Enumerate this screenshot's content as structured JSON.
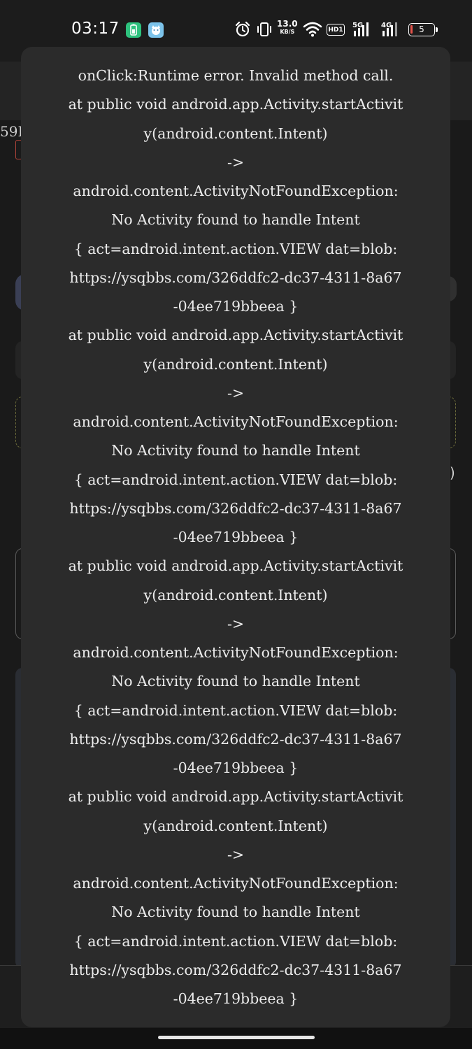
{
  "status_bar": {
    "time": "03:17",
    "net_speed_value": "13.0",
    "net_speed_unit": "KB/S",
    "hd_label": "HD1",
    "signal_1_label": "5G",
    "signal_2_label": "4G",
    "battery_level": "5",
    "icons": [
      "alarm-icon",
      "vibrate-icon",
      "wifi-icon",
      "signal-5g-icon",
      "signal-4g-icon",
      "battery-icon"
    ]
  },
  "background": {
    "partial_text_left": "59I",
    "partial_text_right": ")"
  },
  "toast": {
    "lines": [
      "onClick:Runtime error. Invalid method call.",
      "at public void android.app.Activity.startActivit",
      "y(android.content.Intent)",
      "->",
      "android.content.ActivityNotFoundException:",
      "No Activity found to handle Intent",
      "{ act=android.intent.action.VIEW dat=blob:",
      "https://ysqbbs.com/326ddfc2-dc37-4311-8a67",
      "-04ee719bbeea }",
      "at public void android.app.Activity.startActivit",
      "y(android.content.Intent)",
      "->",
      "android.content.ActivityNotFoundException:",
      "No Activity found to handle Intent",
      "{ act=android.intent.action.VIEW dat=blob:",
      "https://ysqbbs.com/326ddfc2-dc37-4311-8a67",
      "-04ee719bbeea }",
      "at public void android.app.Activity.startActivit",
      "y(android.content.Intent)",
      "->",
      "android.content.ActivityNotFoundException:",
      "No Activity found to handle Intent",
      "{ act=android.intent.action.VIEW dat=blob:",
      "https://ysqbbs.com/326ddfc2-dc37-4311-8a67",
      "-04ee719bbeea }",
      "at public void android.app.Activity.startActivit",
      "y(android.content.Intent)",
      "->",
      "android.content.ActivityNotFoundException:",
      "No Activity found to handle Intent",
      "{ act=android.intent.action.VIEW dat=blob:",
      "https://ysqbbs.com/326ddfc2-dc37-4311-8a67",
      "-04ee719bbeea }"
    ]
  },
  "colors": {
    "toast_background": "#2b2b2b",
    "toast_text": "#ececec",
    "app_icon_green": "#2ec27e",
    "app_icon_blue": "#7cc3ea",
    "battery_low": "#e5534b"
  }
}
